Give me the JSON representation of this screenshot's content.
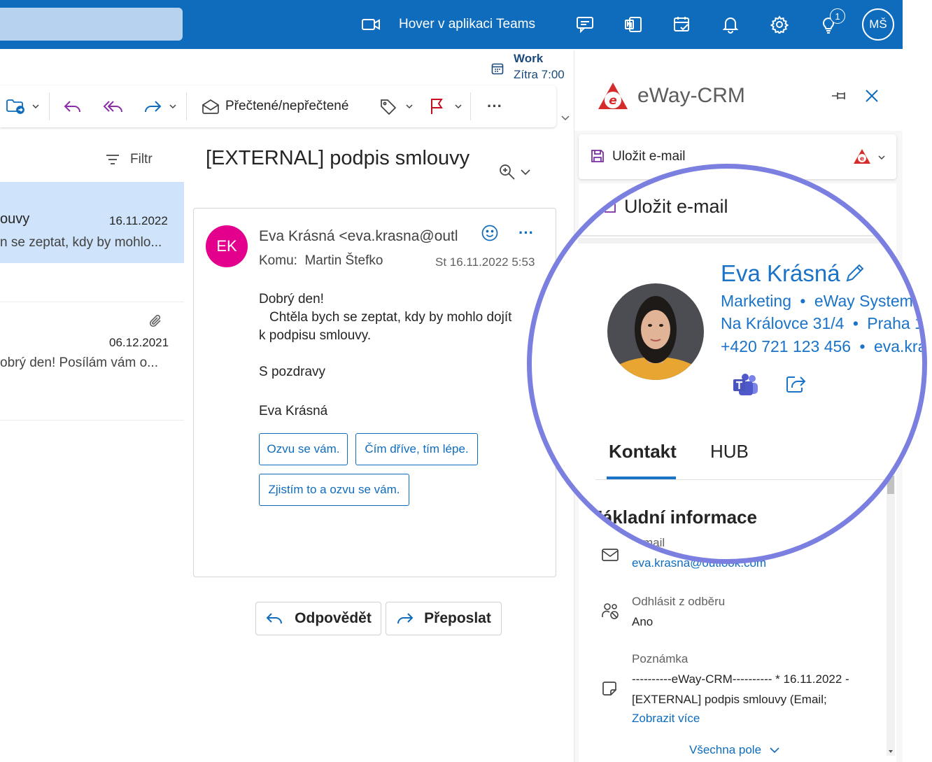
{
  "topbar": {
    "teams_call": "Hover v aplikaci Teams",
    "notification_count": "1",
    "user_initials": "MŠ"
  },
  "reminder": {
    "title": "Work",
    "time": "Zítra 7:00"
  },
  "ribbon": {
    "read_unread": "Přečtené/nepřečtené",
    "more": "···"
  },
  "maillist": {
    "filter": "Filtr",
    "items": [
      {
        "subject_fragment": "ouvy",
        "date": "16.11.2022",
        "preview": "n se zeptat, kdy by mohlo..."
      },
      {
        "date": "06.12.2021",
        "preview": "obrý den! Posílám vám o..."
      }
    ]
  },
  "message": {
    "subject": "[EXTERNAL] podpis smlouvy",
    "avatar_initials": "EK",
    "from": "Eva Krásná <eva.krasna@outl",
    "to_label": "Komu:",
    "to": "Martin Štefko",
    "date": "St 16.11.2022 5:53",
    "body_greeting": "Dobrý den!",
    "body_line1": "Chtěla bych se zeptat, kdy by mohlo dojít",
    "body_line2": "k podpisu smlouvy.",
    "body_regards": "S pozdravy",
    "body_signature": "Eva Krásná",
    "quick_replies": [
      "Ozvu se vám.",
      "Čím dříve, tím lépe.",
      "Zjistím to a ozvu se vám."
    ],
    "reply": "Odpovědět",
    "forward": "Přeposlat"
  },
  "crm": {
    "app_name": "eWay-CRM",
    "save_email": "Uložit e-mail",
    "contact": {
      "name": "Eva Krásná",
      "department": "Marketing",
      "company": "eWay System",
      "street": "Na Královce 31/4",
      "city": "Praha 1",
      "phone": "+420 721 123 456",
      "email_short": "eva.kra",
      "separator": "•"
    },
    "tabs": [
      "Kontakt",
      "HUB"
    ],
    "section_title": "Základní informace",
    "fields": {
      "email_label": "E-mail",
      "email_value": "eva.krasna@outlook.com",
      "unsubscribe_label": "Odhlásit z odběru",
      "unsubscribe_value": "Ano",
      "note_label": "Poznámka",
      "note_line1": "----------eWay-CRM---------- * 16.11.2022 -",
      "note_line2": "[EXTERNAL] podpis smlouvy (Email;",
      "show_more": "Zobrazit více"
    },
    "all_fields": "Všechna pole"
  },
  "colors": {
    "topbar": "#0f6cbd",
    "selected_row": "#cfe4fa",
    "avatar_ek": "#e3008c",
    "magnifier_ring": "#7b7fe0",
    "crm_blue": "#1a73c7",
    "eway_red": "#d62b2b"
  }
}
